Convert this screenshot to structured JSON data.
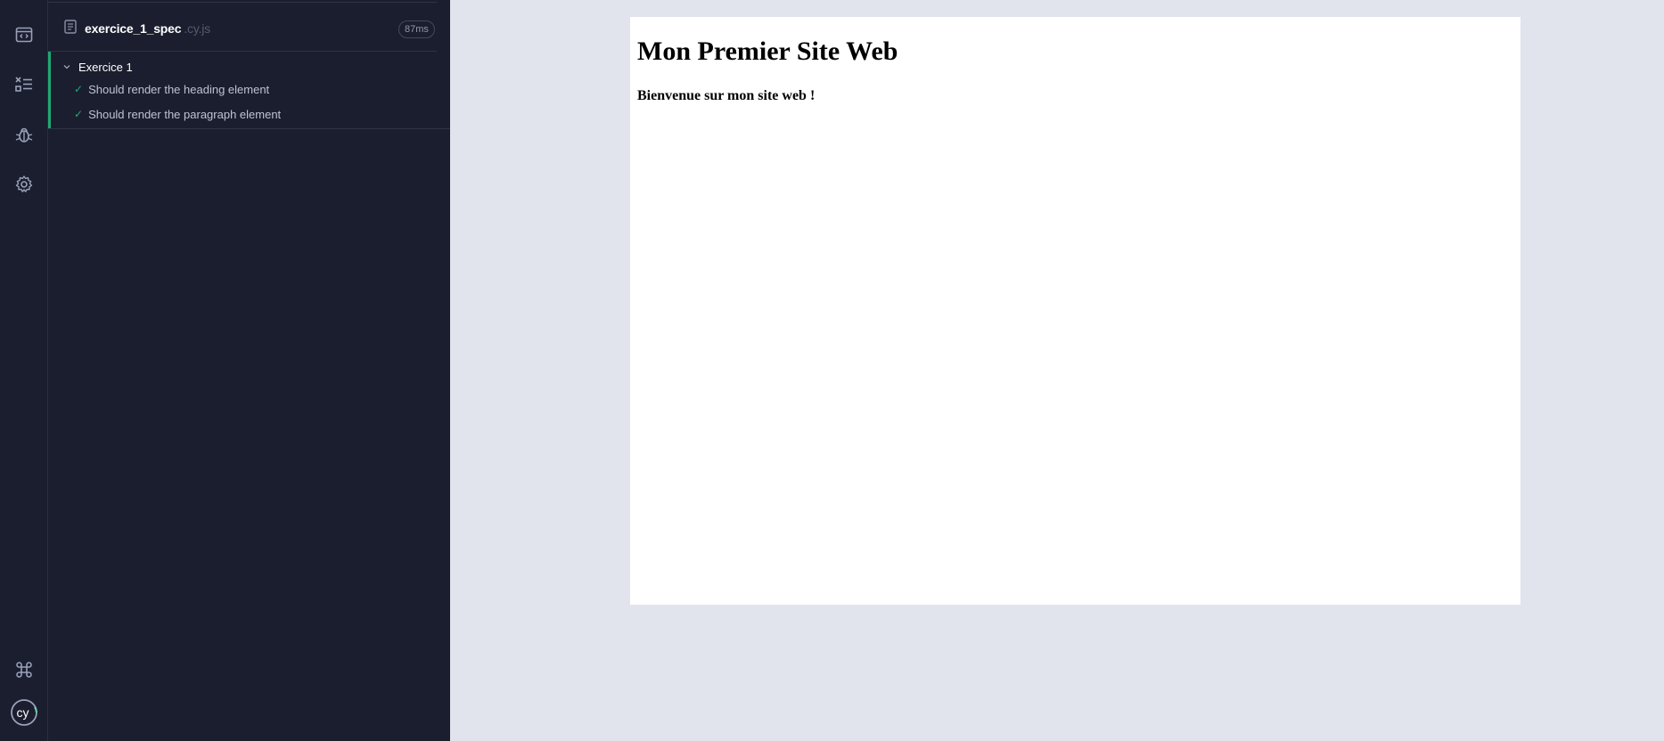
{
  "nav": {
    "items": [
      {
        "name": "specs",
        "icon": "code-window-icon"
      },
      {
        "name": "runs",
        "icon": "checklist-icon"
      },
      {
        "name": "debug",
        "icon": "bug-icon"
      },
      {
        "name": "settings",
        "icon": "gear-icon"
      }
    ],
    "bottom": [
      {
        "name": "keyboard-shortcuts",
        "icon": "command-icon"
      },
      {
        "name": "cypress-logo",
        "icon": "cypress-logo-icon"
      }
    ]
  },
  "spec": {
    "file_name": "exercice_1_spec",
    "file_ext": ".cy.js",
    "duration": "87ms"
  },
  "suite": {
    "title": "Exercice 1",
    "tests": [
      {
        "status": "passed",
        "label": "Should render the heading element"
      },
      {
        "status": "passed",
        "label": "Should render the paragraph element"
      }
    ]
  },
  "aut": {
    "heading": "Mon Premier Site Web",
    "paragraph": "Bienvenue sur mon site web !"
  },
  "colors": {
    "sidebar_bg": "#1b1e2e",
    "pass_green": "#1fa971",
    "aut_bg": "#e1e3ed"
  }
}
